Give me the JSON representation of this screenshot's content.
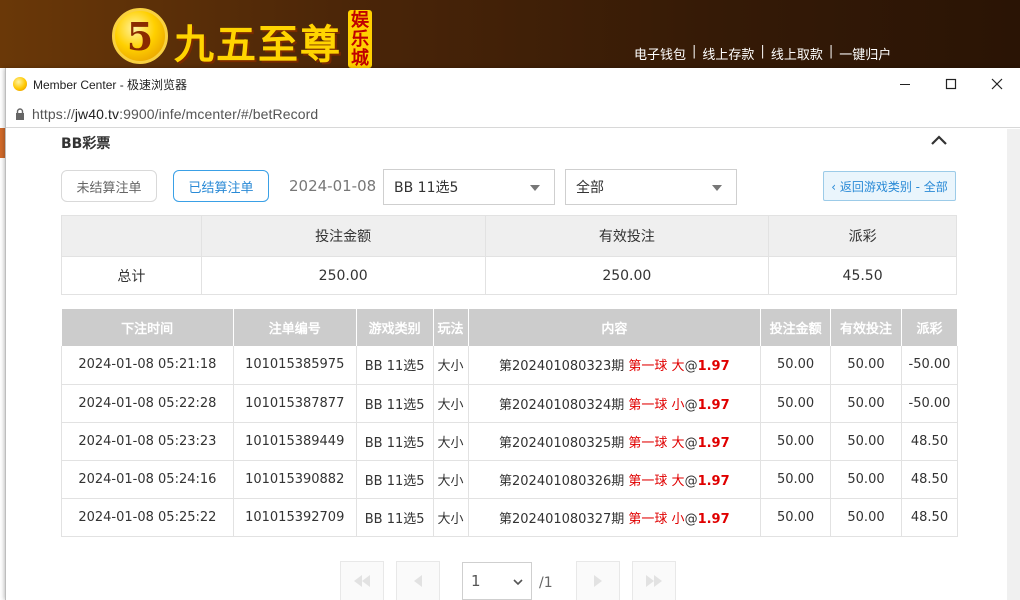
{
  "site": {
    "logo_digit": "5",
    "logo_text": "九五至尊",
    "logo_badge": "娱乐城",
    "links": [
      "电子钱包",
      "线上存款",
      "线上取款",
      "一键归户"
    ]
  },
  "window": {
    "title": "Member Center - 极速浏览器",
    "url_prefix": "https://",
    "url_host": "jw40.tv",
    "url_rest": ":9900/infe/mcenter/#/betRecord"
  },
  "section_title": "BB彩票",
  "filters": {
    "unsettled_label": "未结算注单",
    "settled_label": "已结算注单",
    "date": "2024-01-08",
    "game": "BB 11选5",
    "type": "全部",
    "back_label": "‹ 返回游戏类别 - 全部"
  },
  "summary": {
    "headers": [
      "",
      "投注金额",
      "有效投注",
      "派彩"
    ],
    "row_label": "总计",
    "bet_amount": "250.00",
    "valid_bet": "250.00",
    "payout": "45.50"
  },
  "records": {
    "headers": [
      "下注时间",
      "注单编号",
      "游戏类别",
      "玩法",
      "内容",
      "投注金额",
      "有效投注",
      "派彩"
    ],
    "rows": [
      {
        "time": "2024-01-08 05:21:18",
        "id": "101015385975",
        "game": "BB 11选5",
        "play": "大小",
        "period": "第202401080323期",
        "pick": "第一球 大",
        "at": "@",
        "odds": "1.97",
        "bet": "50.00",
        "valid": "50.00",
        "payout": "-50.00"
      },
      {
        "time": "2024-01-08 05:22:28",
        "id": "101015387877",
        "game": "BB 11选5",
        "play": "大小",
        "period": "第202401080324期",
        "pick": "第一球 小",
        "at": "@",
        "odds": "1.97",
        "bet": "50.00",
        "valid": "50.00",
        "payout": "-50.00"
      },
      {
        "time": "2024-01-08 05:23:23",
        "id": "101015389449",
        "game": "BB 11选5",
        "play": "大小",
        "period": "第202401080325期",
        "pick": "第一球 大",
        "at": "@",
        "odds": "1.97",
        "bet": "50.00",
        "valid": "50.00",
        "payout": "48.50"
      },
      {
        "time": "2024-01-08 05:24:16",
        "id": "101015390882",
        "game": "BB 11选5",
        "play": "大小",
        "period": "第202401080326期",
        "pick": "第一球 大",
        "at": "@",
        "odds": "1.97",
        "bet": "50.00",
        "valid": "50.00",
        "payout": "48.50"
      },
      {
        "time": "2024-01-08 05:25:22",
        "id": "101015392709",
        "game": "BB 11选5",
        "play": "大小",
        "period": "第202401080327期",
        "pick": "第一球 小",
        "at": "@",
        "odds": "1.97",
        "bet": "50.00",
        "valid": "50.00",
        "payout": "48.50"
      }
    ]
  },
  "pager": {
    "current": "1",
    "total": "/1"
  },
  "colors": {
    "accent": "#2a8ad6",
    "negative": "#e03030",
    "header_brown": "#4a2508",
    "table_header": "#cccccc"
  },
  "icons": [
    "lock-icon",
    "minimize-icon",
    "maximize-icon",
    "close-icon",
    "collapse-chevron-icon",
    "first-page-icon",
    "prev-page-icon",
    "next-page-icon",
    "last-page-icon",
    "dropdown-caret-icon"
  ]
}
